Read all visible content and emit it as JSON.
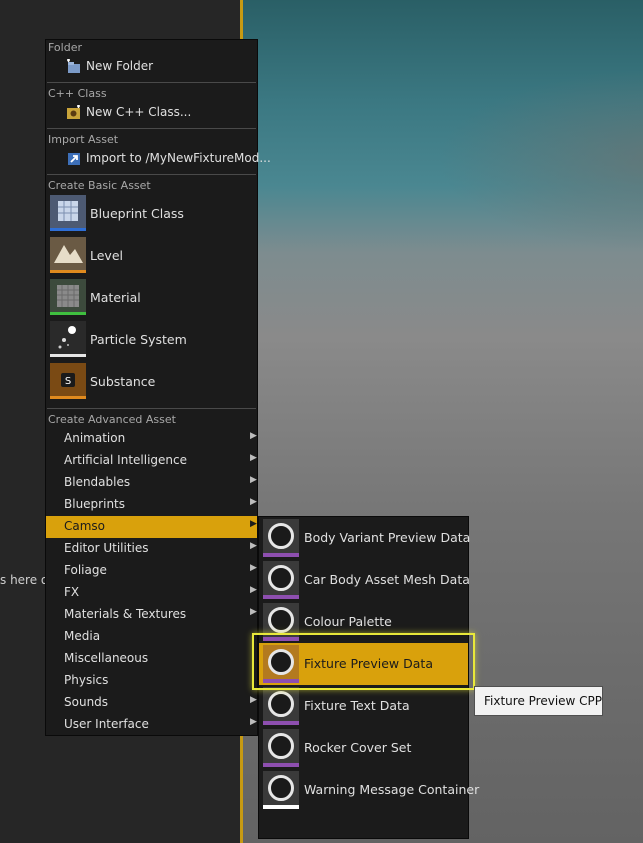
{
  "left_pane": {
    "hint_text": "s here or"
  },
  "context_menu": {
    "sections": [
      {
        "header": "Folder",
        "items": [
          {
            "label": "New Folder",
            "icon": "new-folder-icon"
          }
        ]
      },
      {
        "header": "C++ Class",
        "items": [
          {
            "label": "New C++ Class...",
            "icon": "cpp-class-icon"
          }
        ]
      },
      {
        "header": "Import Asset",
        "items": [
          {
            "label": "Import to /MyNewFixtureMod...",
            "icon": "import-icon"
          }
        ]
      }
    ],
    "basic": {
      "header": "Create Basic Asset",
      "items": [
        {
          "label": "Blueprint Class",
          "icon": "blueprint-class-icon",
          "color": "#2f6fd6"
        },
        {
          "label": "Level",
          "icon": "level-icon",
          "color": "#e08a1e"
        },
        {
          "label": "Material",
          "icon": "material-icon",
          "color": "#3fbf3f"
        },
        {
          "label": "Particle System",
          "icon": "particle-system-icon",
          "color": "#e6e6e6"
        },
        {
          "label": "Substance",
          "icon": "substance-icon",
          "color": "#e08a1e"
        }
      ]
    },
    "advanced": {
      "header": "Create Advanced Asset",
      "items": [
        {
          "label": "Animation",
          "has_submenu": true
        },
        {
          "label": "Artificial Intelligence",
          "has_submenu": true
        },
        {
          "label": "Blendables",
          "has_submenu": true
        },
        {
          "label": "Blueprints",
          "has_submenu": true
        },
        {
          "label": "Camso",
          "has_submenu": true,
          "active": true
        },
        {
          "label": "Editor Utilities",
          "has_submenu": true
        },
        {
          "label": "Foliage",
          "has_submenu": true
        },
        {
          "label": "FX",
          "has_submenu": true
        },
        {
          "label": "Materials & Textures",
          "has_submenu": true
        },
        {
          "label": "Media",
          "has_submenu": false
        },
        {
          "label": "Miscellaneous",
          "has_submenu": false
        },
        {
          "label": "Physics",
          "has_submenu": false
        },
        {
          "label": "Sounds",
          "has_submenu": true
        },
        {
          "label": "User Interface",
          "has_submenu": true
        }
      ],
      "arrow_glyph": "▶"
    }
  },
  "submenu": {
    "items": [
      {
        "label": "Body Variant Preview Data",
        "icon": "data-asset-icon"
      },
      {
        "label": "Car Body Asset Mesh Data",
        "icon": "data-asset-icon"
      },
      {
        "label": "Colour Palette",
        "icon": "data-asset-icon"
      },
      {
        "label": "Fixture Preview Data",
        "icon": "data-asset-icon",
        "active": true
      },
      {
        "label": "Fixture Text Data",
        "icon": "data-asset-icon"
      },
      {
        "label": "Rocker Cover Set",
        "icon": "data-asset-icon"
      },
      {
        "label": "Warning Message Container",
        "icon": "data-asset-icon",
        "bar_color": "#ffffff"
      }
    ]
  },
  "tooltip": {
    "text": "Fixture Preview CPP"
  },
  "colors": {
    "accent": "#d9a10c",
    "highlight": "#e8e83a",
    "submenu_bar": "#8e4fb0"
  }
}
